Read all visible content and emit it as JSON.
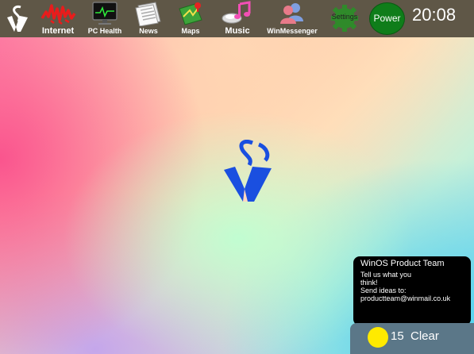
{
  "taskbar": {
    "apps": [
      {
        "label": "Internet",
        "icon": "internet-icon"
      },
      {
        "label": "PC Health",
        "icon": "pc-health-icon"
      },
      {
        "label": "News",
        "icon": "news-icon"
      },
      {
        "label": "Maps",
        "icon": "maps-icon"
      },
      {
        "label": "Music",
        "icon": "music-icon"
      },
      {
        "label": "WinMessenger",
        "icon": "messenger-icon"
      }
    ],
    "settings_label": "Settings",
    "power_label": "Power",
    "clock": "20:08",
    "colors": {
      "bar": "#5f5747",
      "power": "#0f7d1a",
      "settings": "#2f8a2a",
      "logo": "#1a4fe0"
    }
  },
  "notification": {
    "title": "WinOS Product Team",
    "body": "Tell us what you\nthink!\nSend ideas to:\nproductteam@winmail.co.uk"
  },
  "weather": {
    "temperature": "15",
    "condition": "Clear",
    "icon": "sun-icon"
  }
}
